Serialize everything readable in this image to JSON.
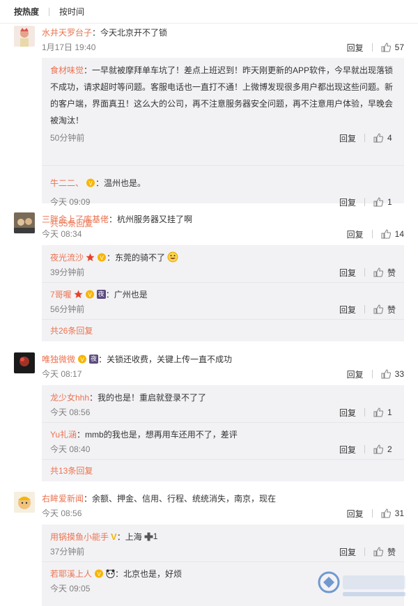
{
  "sort": {
    "hot": "按热度",
    "time": "按时间"
  },
  "reply_label": "回复",
  "like_text_label": "赞",
  "comments": [
    {
      "user": "水井天罗台子",
      "colon": "：",
      "text": "今天北京开不了锁",
      "time": "1月17日 19:40",
      "likes": "57",
      "replies": [
        {
          "user": "食材味觉",
          "colon": "：",
          "text": "一早就被摩拜单车坑了！差点上班迟到！昨天刚更新的APP软件，今早就出现落锁不成功，请求超时等问题。客服电话也一直打不通！上微博发现很多用户都出现这些问题。新的客户端，界面真丑！这么大的公司，再不注意服务器安全问题，再不注意用户体验，早晚会被淘汰！",
          "time": "50分钟前",
          "likes": "4"
        },
        {
          "user": "牛二二、",
          "colon": "：",
          "text": "温州也是。",
          "time": "今天 09:09",
          "likes": "1"
        }
      ],
      "more": "共55条回复"
    },
    {
      "user": "三胖金上了库基佬",
      "colon": "：",
      "text": "杭州服务器又挂了啊",
      "time": "今天 08:34",
      "likes": "14",
      "replies": [
        {
          "user": "夜光流沙",
          "colon": "：",
          "text": "东莞的骑不了",
          "time": "39分钟前",
          "likes": "赞"
        },
        {
          "user": "7哥喔",
          "colon": "：",
          "text": "广州也是",
          "time": "56分钟前",
          "likes": "赞"
        }
      ],
      "more": "共26条回复"
    },
    {
      "user": "唯独微微",
      "colon": "：",
      "text": "关锁还收费，关键上传一直不成功",
      "time": "今天 08:17",
      "likes": "33",
      "replies": [
        {
          "user": "龙少女hhh",
          "colon": "：",
          "text": "我的也是！重启就登录不了了",
          "time": "今天 08:56",
          "likes": "1"
        },
        {
          "user": "Yu礼涵",
          "colon": "：",
          "text": "mmb的我也是，想再用车还用不了，差评",
          "time": "今天 08:40",
          "likes": "2"
        }
      ],
      "more": "共13条回复"
    },
    {
      "user": "右眸爱新闻",
      "colon": "：",
      "text": "余额、押金、信用、行程、统统消失，南京，现在",
      "time": "今天 08:56",
      "likes": "31",
      "replies": [
        {
          "user": "用锅摸鱼小能手",
          "colon": "：",
          "text": "上海",
          "plus": "1",
          "time": "37分钟前",
          "likes": "赞"
        },
        {
          "user": "若耶溪上人",
          "colon": "：",
          "text": "北京也是，好烦",
          "time": "今天 09:05",
          "likes": ""
        }
      ]
    }
  ],
  "badges": {
    "night": "夜",
    "v": "V"
  },
  "icons": [
    "thumb-up-icon",
    "crown-badge-icon",
    "vip-badge-icon",
    "night-badge-icon",
    "laugh-emoji-icon",
    "panda-badge-icon",
    "cross-emoji-icon",
    "watermark-logo"
  ],
  "colors": {
    "username": "#eb7350",
    "subbg": "#f2f2f5",
    "meta": "#808080"
  }
}
